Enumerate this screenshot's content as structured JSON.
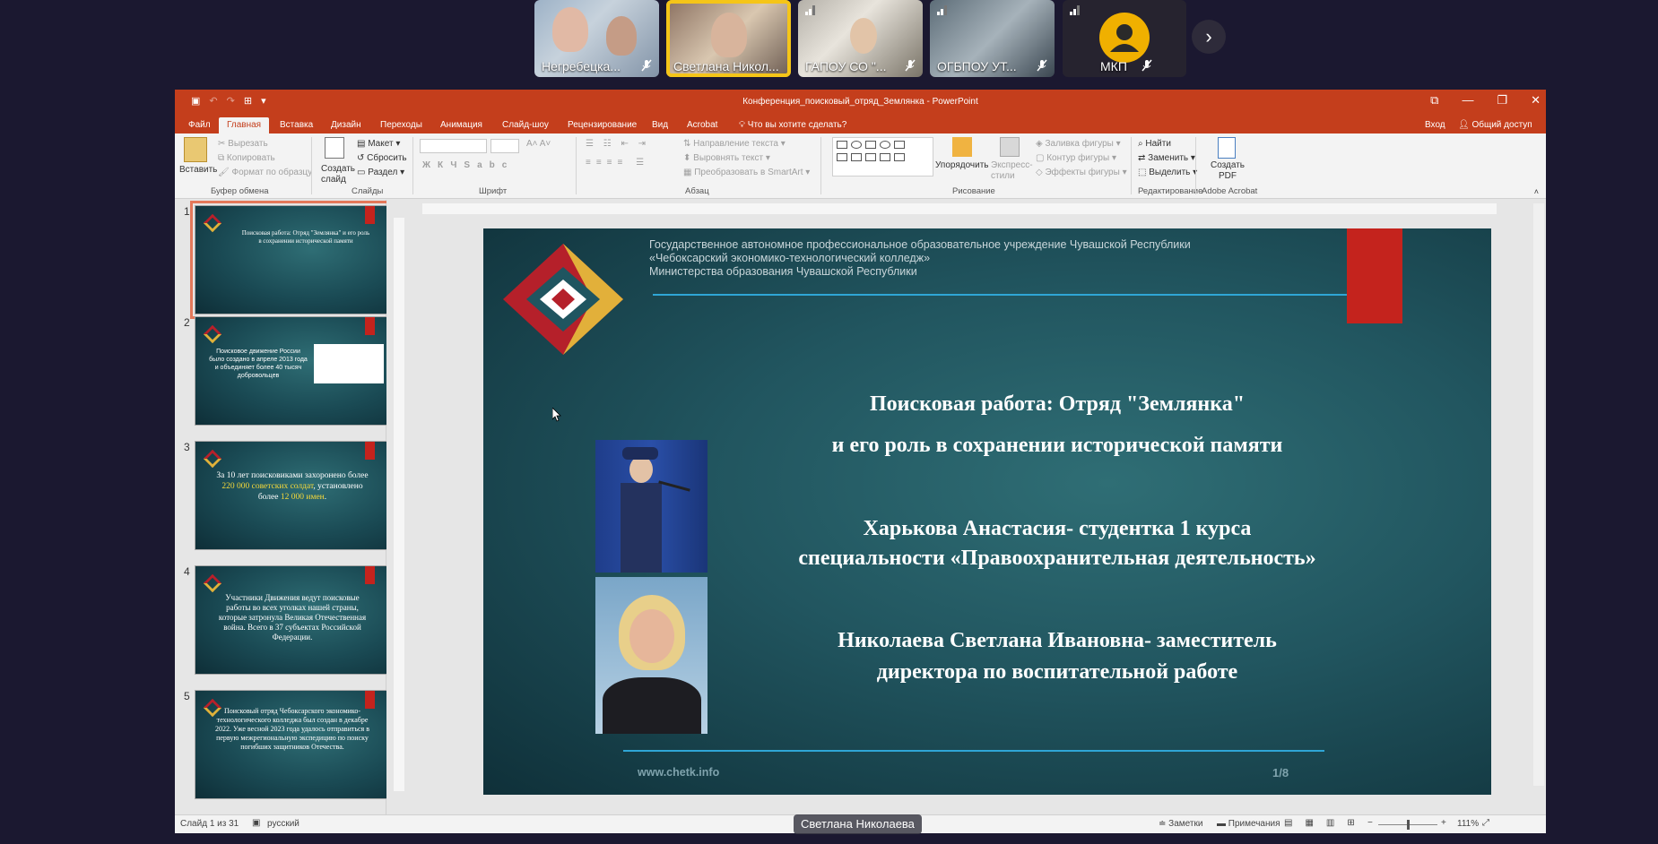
{
  "participants": [
    {
      "name": "Негребецка...",
      "muted": true
    },
    {
      "name": "Светлана Никол...",
      "muted": false,
      "active": true
    },
    {
      "name": "ГАПОУ СО \"...",
      "muted": true
    },
    {
      "name": "ОГБПОУ УТ...",
      "muted": true
    },
    {
      "name": "МКП",
      "muted": true
    }
  ],
  "window": {
    "title": "Конференция_поисковый_отряд_Землянка - PowerPoint",
    "signin": "Вход",
    "share": "Общий доступ"
  },
  "tabs": [
    "Файл",
    "Главная",
    "Вставка",
    "Дизайн",
    "Переходы",
    "Анимация",
    "Слайд-шоу",
    "Рецензирование",
    "Вид",
    "Acrobat"
  ],
  "tell_me": "Что вы хотите сделать?",
  "ribbon": {
    "paste": "Вставить",
    "cut": "Вырезать",
    "copy": "Копировать",
    "format_painter": "Формат по образцу",
    "clipboard_group": "Буфер обмена",
    "new_slide": "Создать слайд",
    "layout": "Макет",
    "reset": "Сбросить",
    "section": "Раздел",
    "slides_group": "Слайды",
    "font_group": "Шрифт",
    "text_direction": "Направление текста",
    "align_text": "Выровнять текст",
    "smartart": "Преобразовать в SmartArt",
    "paragraph_group": "Абзац",
    "arrange": "Упорядочить",
    "quick_styles": "Экспресс-стили",
    "shape_fill": "Заливка фигуры",
    "shape_outline": "Контур фигуры",
    "shape_effects": "Эффекты фигуры",
    "drawing_group": "Рисование",
    "find": "Найти",
    "replace": "Заменить",
    "select": "Выделить",
    "editing_group": "Редактирование",
    "create_pdf": "Создать PDF",
    "acrobat_group": "Adobe Acrobat"
  },
  "thumbnails": [
    {
      "num": "1",
      "text": "Поисковая работа: Отряд \"Землянка\" и его роль в сохранении исторической памяти"
    },
    {
      "num": "2",
      "text": "Поисковое движение России было создано в апреле 2013 года и объединяет более 40 тысяч добровольцев"
    },
    {
      "num": "3",
      "text_a": "За 10 лет поисковиками захоронено более ",
      "hl_a": "220 000 советских солдат",
      "text_b": ", установлено более ",
      "hl_b": "12 000 имен",
      "text_c": "."
    },
    {
      "num": "4",
      "text": "Участники Движения ведут поисковые работы во всех уголках нашей страны, которые затронула Великая Отечественная война. Всего в 37 субъектах Российской Федерации."
    },
    {
      "num": "5",
      "text": "Поисковый отряд Чебоксарского экономико-технологического колледжа был создан в декабре 2022. Уже весной 2023 года удалось отправиться в первую межрегиональную экспедицию по поиску погибших защитников Отечества."
    }
  ],
  "slide": {
    "org_line1": "Государственное автономное профессиональное образовательное учреждение Чувашской Республики",
    "org_line2": "«Чебоксарский экономико-технологический колледж»",
    "org_line3": "Министерства образования Чувашской Республики",
    "title_line1": "Поисковая работа: Отряд \"Землянка\"",
    "title_line2": "и его роль в сохранении исторической памяти",
    "author1_line1": "Харькова Анастасия- студентка 1 курса",
    "author1_line2": "специальности «Правоохранительная деятельность»",
    "author2_line1": "Николаева Светлана Ивановна- заместитель",
    "author2_line2": "директора по воспитательной работе",
    "website": "www.chetk.info",
    "page": "1/8"
  },
  "status": {
    "slide_counter": "Слайд 1 из 31",
    "language": "русский",
    "notes": "Заметки",
    "comments": "Примечания",
    "zoom": "111%"
  },
  "speaker_label": "Светлана Николаева",
  "colors": {
    "accent": "#c43e1c",
    "slide_bg": "#21555f",
    "highlight": "#f4d83a",
    "active_speaker": "#f5c518"
  }
}
